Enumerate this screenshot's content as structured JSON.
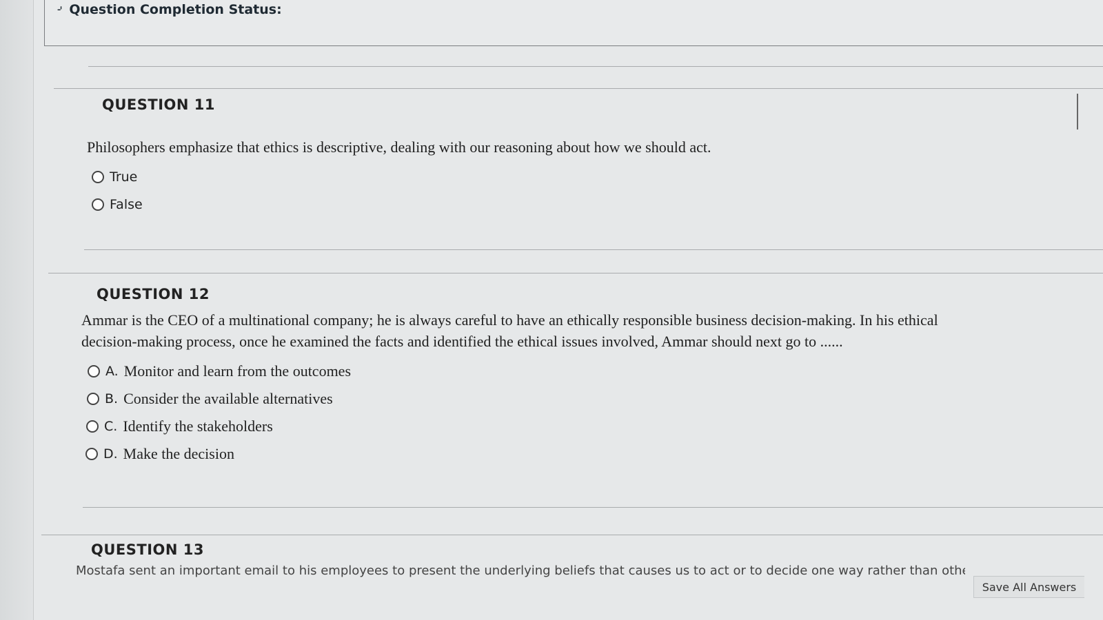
{
  "status": {
    "label": "Question Completion Status:"
  },
  "questions": [
    {
      "title": "QUESTION 11",
      "text": "Philosophers emphasize that ethics is descriptive, dealing with our reasoning about how we should act.",
      "options": [
        {
          "label": "True"
        },
        {
          "label": "False"
        }
      ]
    },
    {
      "title": "QUESTION 12",
      "text_line1": "Ammar is the CEO of a multinational company; he is always careful to have an ethically responsible business decision-making.  In his ethical",
      "text_line2": "decision-making process, once he examined the facts and identified the ethical issues involved, Ammar should next go to ......",
      "options": [
        {
          "letter": "A.",
          "text": "Monitor and learn from the outcomes"
        },
        {
          "letter": "B.",
          "text": "Consider the available alternatives"
        },
        {
          "letter": "C.",
          "text": "Identify the stakeholders"
        },
        {
          "letter": "D.",
          "text": "Make the decision"
        }
      ]
    },
    {
      "title": "QUESTION 13",
      "text_line1": "Mostafa sent an important email to his employees to present the underlying beliefs that causes us to act or to decide one way rather than other"
    }
  ],
  "footer": {
    "save_all": "Save All Answers"
  }
}
